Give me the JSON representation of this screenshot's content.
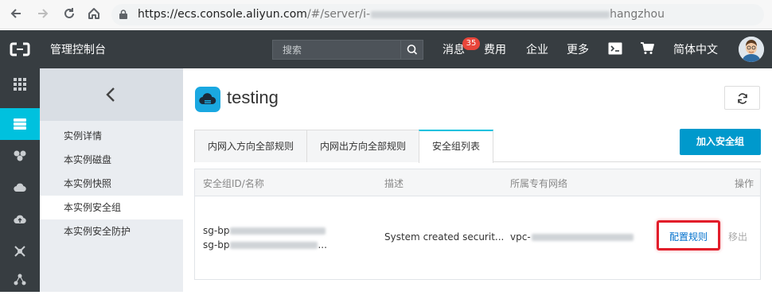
{
  "browser": {
    "back_icon": "arrow-left-icon",
    "forward_icon": "arrow-right-icon",
    "reload_icon": "reload-icon",
    "home_icon": "home-icon",
    "url_host": "https://ecs.console.aliyun.com",
    "url_path_start": "/#/server/i-",
    "url_path_end": "hangzhou"
  },
  "topnav": {
    "title": "管理控制台",
    "search_placeholder": "搜索",
    "messages_label": "消息",
    "messages_count": "35",
    "fees_label": "费用",
    "enterprise_label": "企业",
    "more_label": "更多",
    "language_label": "简体中文"
  },
  "subnav": {
    "items": [
      {
        "label": "实例详情"
      },
      {
        "label": "本实例磁盘"
      },
      {
        "label": "本实例快照"
      },
      {
        "label": "本实例安全组"
      },
      {
        "label": "本实例安全防护"
      }
    ]
  },
  "main": {
    "title": "testing",
    "tabs": [
      {
        "label": "内网入方向全部规则"
      },
      {
        "label": "内网出方向全部规则"
      },
      {
        "label": "安全组列表"
      }
    ],
    "add_group_label": "加入安全组",
    "table": {
      "headers": [
        "安全组ID/名称",
        "描述",
        "所属专有网络",
        "操作"
      ],
      "row": {
        "id_line1_prefix": "sg-bp",
        "id_line2_prefix": "sg-bp",
        "id_line2_suffix": "...",
        "description": "System created securit...",
        "vpc_prefix": "vpc-",
        "config_label": "配置规则",
        "remove_label": "移出"
      }
    }
  },
  "colors": {
    "topbar": "#373d41",
    "accent": "#00c1de",
    "primary_button": "#0099cc",
    "highlight_box": "#e21d2a",
    "link": "#0070cc"
  }
}
